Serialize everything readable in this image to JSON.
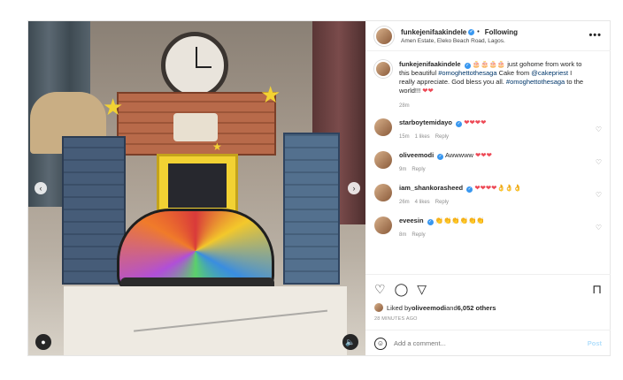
{
  "post": {
    "username": "funkejenifaakindele",
    "follow_label": "Following",
    "location": "Amen Estate, Eleko Beach Road, Lagos.",
    "more_label": "•••"
  },
  "caption": {
    "username": "funkejenifaakindele",
    "emoji_prefix": "🎂🎂🎂🎂",
    "text_1": " just gohome from work to this beautiful ",
    "hashtag_1": "#omoghettothesaga",
    "text_2": " Cake from ",
    "mention": "@cakepriest",
    "text_3": " I really appreciate. God bless you all. ",
    "hashtag_2": "#omoghettothesaga",
    "text_4": " to the world!!! ",
    "hearts": "❤❤",
    "time": "28m"
  },
  "comments": [
    {
      "username": "starboytemidayo",
      "text": "",
      "hearts": "❤❤❤❤",
      "time": "15m",
      "likes": "1 likes",
      "reply": "Reply"
    },
    {
      "username": "oliveemodi",
      "text": "Awwwww ",
      "hearts": "❤❤❤",
      "time": "9m",
      "reply": "Reply"
    },
    {
      "username": "iam_shankorasheed",
      "text": "",
      "hearts": "❤❤❤❤👌👌👌",
      "time": "26m",
      "likes": "4 likes",
      "reply": "Reply"
    },
    {
      "username": "eveesin",
      "text": "",
      "hearts": "👏👏👏👏👏👏",
      "time": "8m",
      "reply": "Reply"
    }
  ],
  "actions": {
    "like_icon": "♡",
    "comment_icon": "◯",
    "share_icon": "▽",
    "bookmark_icon": "⊓",
    "liked_by_prefix": "Liked by ",
    "liked_by_user": "oliveemodi",
    "liked_by_and": " and ",
    "liked_by_others": "6,052 others",
    "time_ago": "28 MINUTES AGO"
  },
  "comment_box": {
    "placeholder": "Add a comment...",
    "post_label": "Post",
    "emoji_icon": "☺"
  },
  "media": {
    "prev_icon": "‹",
    "next_icon": "›",
    "user_icon": "●",
    "sound_icon": "🔈"
  }
}
